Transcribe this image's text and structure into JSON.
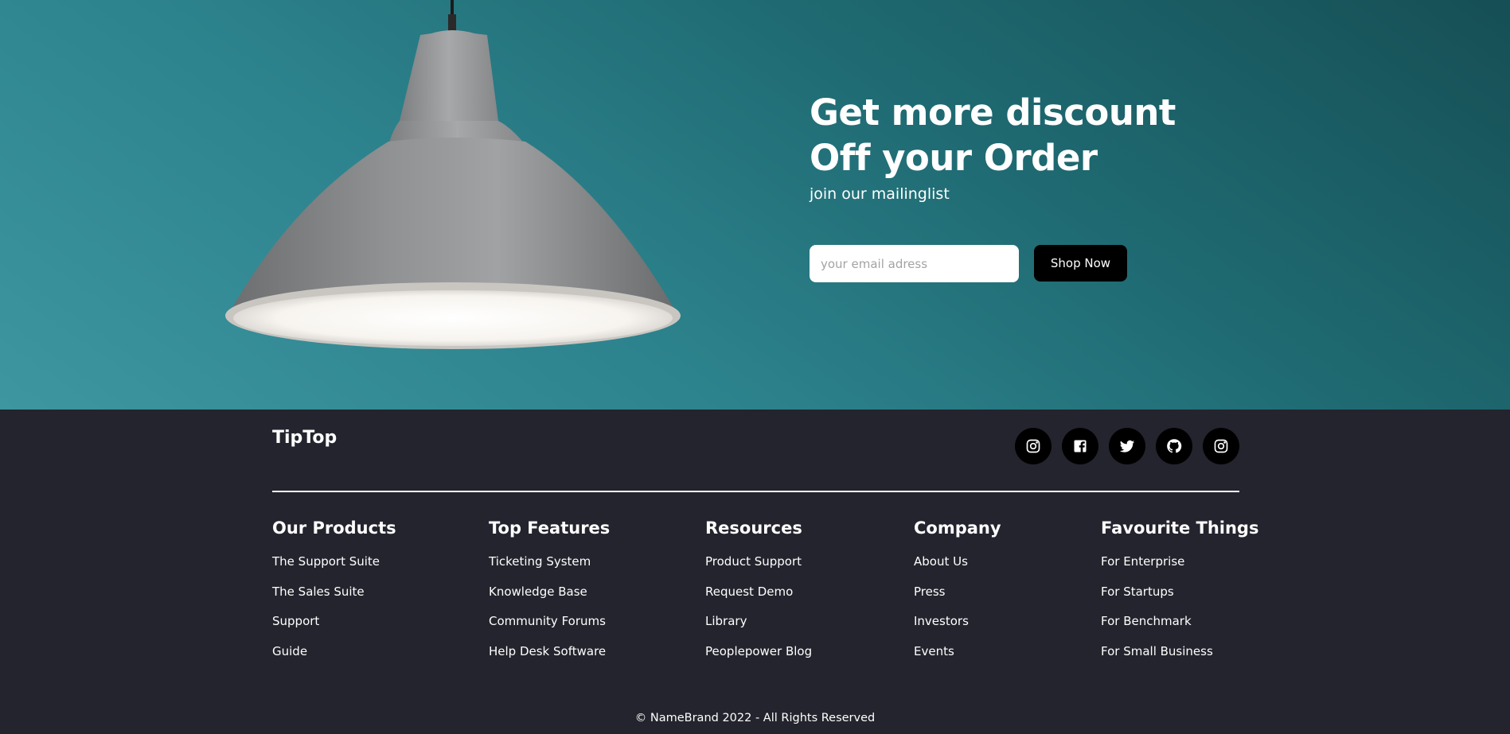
{
  "hero": {
    "title_line1": "Get more discount",
    "title_line2": "Off your Order",
    "subtitle": "join our mailinglist",
    "email_placeholder": "your email adress",
    "button_label": "Shop Now",
    "background_color": "#2a7f89"
  },
  "footer": {
    "brand": "TipTop",
    "socials": [
      "instagram-icon",
      "facebook-icon",
      "twitter-icon",
      "github-icon",
      "instagram-icon"
    ],
    "columns": [
      {
        "title": "Our Products",
        "links": [
          "The Support Suite",
          "The Sales Suite",
          "Support",
          "Guide"
        ]
      },
      {
        "title": "Top Features",
        "links": [
          "Ticketing System",
          "Knowledge Base",
          "Community Forums",
          "Help Desk Software"
        ]
      },
      {
        "title": "Resources",
        "links": [
          "Product Support",
          "Request Demo",
          "Library",
          "Peoplepower Blog"
        ]
      },
      {
        "title": "Company",
        "links": [
          "About Us",
          "Press",
          "Investors",
          "Events"
        ]
      },
      {
        "title": "Favourite Things",
        "links": [
          "For Enterprise",
          "For Startups",
          "For Benchmark",
          "For Small Business"
        ]
      }
    ],
    "copyright": "© NameBrand 2022 - All Rights Reserved",
    "background_color": "#23242d"
  }
}
